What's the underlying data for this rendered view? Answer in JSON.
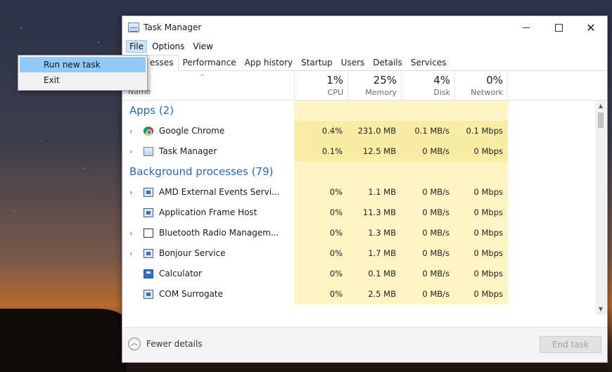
{
  "window": {
    "title": "Task Manager"
  },
  "menubar": {
    "file": "File",
    "options": "Options",
    "view": "View"
  },
  "file_menu": {
    "items": [
      "Run new task",
      "Exit"
    ]
  },
  "tabs": [
    "Processes",
    "Performance",
    "App history",
    "Startup",
    "Users",
    "Details",
    "Services"
  ],
  "tab_visible_text": "esses",
  "columns": {
    "name": "Name",
    "cpu": {
      "pct": "1%",
      "label": "CPU"
    },
    "memory": {
      "pct": "25%",
      "label": "Memory"
    },
    "disk": {
      "pct": "4%",
      "label": "Disk"
    },
    "network": {
      "pct": "0%",
      "label": "Network"
    }
  },
  "groups": {
    "apps": "Apps (2)",
    "background": "Background processes (79)"
  },
  "processes": [
    {
      "name": "Google Chrome",
      "cpu": "0.4%",
      "memory": "231.0 MB",
      "disk": "0.1 MB/s",
      "network": "0.1 Mbps",
      "icon": "chrome-icon"
    },
    {
      "name": "Task Manager",
      "cpu": "0.1%",
      "memory": "12.5 MB",
      "disk": "0 MB/s",
      "network": "0 Mbps",
      "icon": "task-manager-icon"
    },
    {
      "name": "AMD External Events Servi...",
      "cpu": "0%",
      "memory": "1.1 MB",
      "disk": "0 MB/s",
      "network": "0 Mbps",
      "icon": "service-icon"
    },
    {
      "name": "Application Frame Host",
      "cpu": "0%",
      "memory": "11.3 MB",
      "disk": "0 MB/s",
      "network": "0 Mbps",
      "icon": "service-icon"
    },
    {
      "name": "Bluetooth Radio Managem...",
      "cpu": "0%",
      "memory": "1.3 MB",
      "disk": "0 MB/s",
      "network": "0 Mbps",
      "icon": "window-icon"
    },
    {
      "name": "Bonjour Service",
      "cpu": "0%",
      "memory": "1.7 MB",
      "disk": "0 MB/s",
      "network": "0 Mbps",
      "icon": "service-icon"
    },
    {
      "name": "Calculator",
      "cpu": "0%",
      "memory": "0.1 MB",
      "disk": "0 MB/s",
      "network": "0 Mbps",
      "icon": "calculator-icon"
    },
    {
      "name": "COM Surrogate",
      "cpu": "0%",
      "memory": "2.5 MB",
      "disk": "0 MB/s",
      "network": "0 Mbps",
      "icon": "service-icon"
    }
  ],
  "footer": {
    "fewer_details": "Fewer details",
    "end_task": "End task"
  }
}
